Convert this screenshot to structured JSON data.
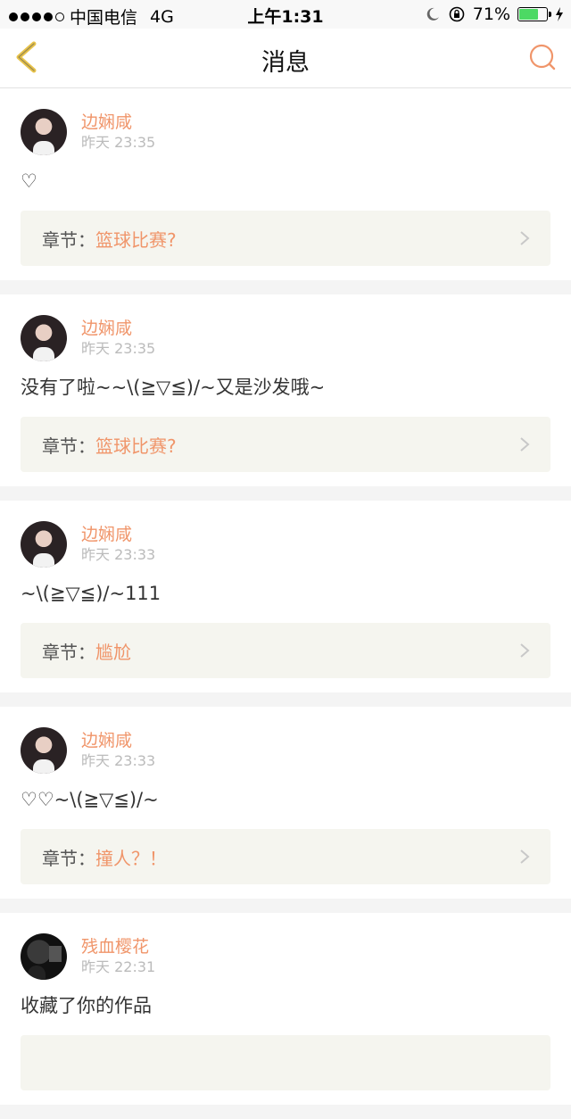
{
  "statusbar": {
    "carrier": "中国电信",
    "network": "4G",
    "time": "上午1:31",
    "battery": "71%",
    "battery_level": 0.71
  },
  "nav": {
    "title": "消息"
  },
  "messages": [
    {
      "user": "边娴咸",
      "time": "昨天 23:35",
      "text": "♡",
      "chapter_label": "章节：",
      "chapter_title": "篮球比赛?"
    },
    {
      "user": "边娴咸",
      "time": "昨天 23:35",
      "text": "没有了啦~~\\(≧▽≦)/~又是沙发哦~",
      "chapter_label": "章节：",
      "chapter_title": "篮球比赛?"
    },
    {
      "user": "边娴咸",
      "time": "昨天 23:33",
      "text": "~\\(≧▽≦)/~111",
      "chapter_label": "章节：",
      "chapter_title": "尴尬"
    },
    {
      "user": "边娴咸",
      "time": "昨天 23:33",
      "text": "♡♡~\\(≧▽≦)/~",
      "chapter_label": "章节：",
      "chapter_title": "撞人？！"
    },
    {
      "user": "残血樱花",
      "time": "昨天 22:31",
      "text": "收藏了你的作品",
      "chapter_label": "",
      "chapter_title": ""
    }
  ],
  "colors": {
    "accent": "#f0956a",
    "back_arrow": "#e8c34a",
    "chapter_bg": "#f5f5ef"
  }
}
